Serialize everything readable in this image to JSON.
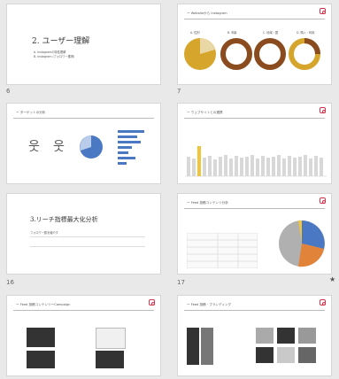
{
  "slides": [
    {
      "number": "6",
      "title": "2. ユーザー理解",
      "items": [
        "A.   Instagramの特性理解",
        "B.   Instagram (フォロワー獲得)"
      ]
    },
    {
      "number": "7",
      "header": "ー Websiteから Instagram",
      "labels": [
        "A. 性別",
        "B. 年齢",
        "C. 地域・国",
        "D. 購入・利用"
      ]
    },
    {
      "number": "",
      "header": "ー ターゲットの分析"
    },
    {
      "number": "",
      "header": "ー ウェブサイトとの連携"
    },
    {
      "number": "16",
      "title": "3.リーチ指標最大化分析",
      "lines": [
        "フォロワー数を増やす"
      ]
    },
    {
      "number": "17",
      "header": "ー Feed 投稿コンテンツ分析"
    },
    {
      "number": "",
      "header": "ー Feed 投稿コンテンツーCampaign"
    },
    {
      "number": "",
      "header": "ー Feed 投稿・ブランディング"
    }
  ],
  "colors": {
    "donut_gold": "#d6a52b",
    "donut_brown": "#8a4b1e",
    "pie_blue": "#4a78c2",
    "pie_orange": "#e2833a",
    "pie_gray": "#b0b0b0",
    "pie_yellow": "#f2c43a",
    "ig_red": "#d2324b"
  }
}
